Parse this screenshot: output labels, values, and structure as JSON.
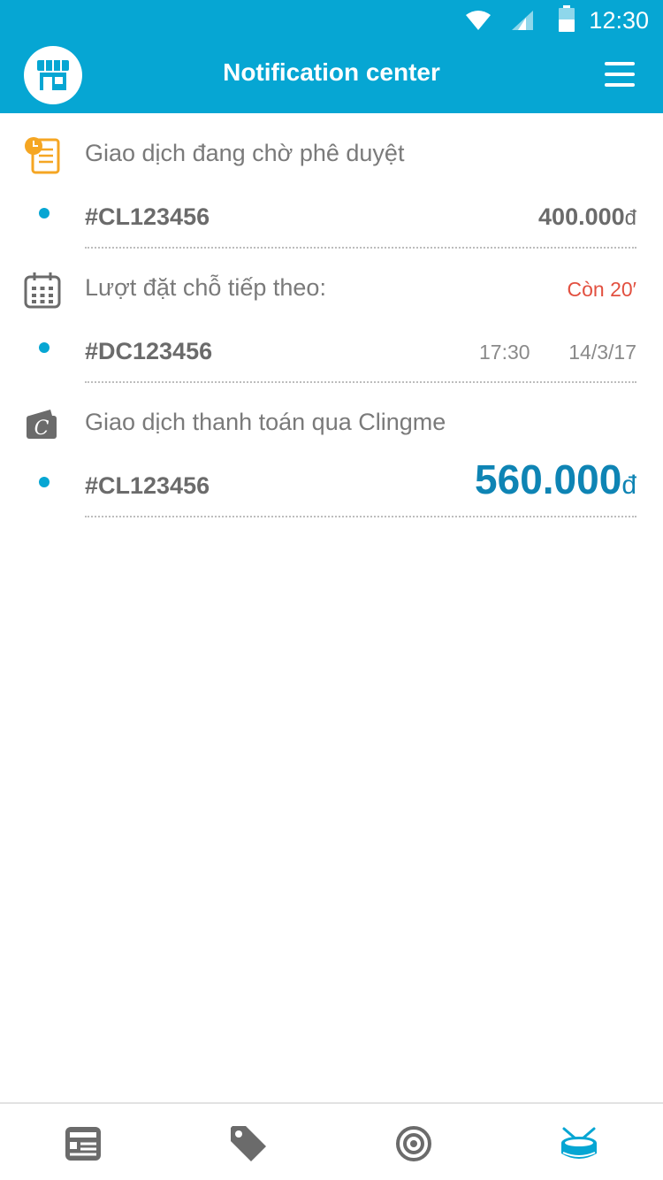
{
  "status_bar": {
    "time": "12:30"
  },
  "header": {
    "title": "Notification center"
  },
  "sections": [
    {
      "title": "Giao dịch đang chờ phê duyệt",
      "item": {
        "code": "#CL123456",
        "amount": "400.000",
        "currency": "đ"
      }
    },
    {
      "title": "Lượt đặt chỗ tiếp theo:",
      "badge": "Còn 20′",
      "item": {
        "code": "#DC123456",
        "time": "17:30",
        "date": "14/3/17"
      }
    },
    {
      "title": "Giao dịch thanh toán qua Clingme",
      "item": {
        "code": "#CL123456",
        "amount": "560.000",
        "currency": "đ"
      }
    }
  ],
  "tabs": [
    {
      "icon": "news-icon"
    },
    {
      "icon": "tag-icon"
    },
    {
      "icon": "target-icon"
    },
    {
      "icon": "drum-icon",
      "active": true
    }
  ],
  "colors": {
    "primary": "#06A6D3",
    "amount_highlight": "#0E84B4",
    "alert": "#e25040",
    "pending_icon": "#F5A623",
    "text_gray": "#7a7a7a"
  }
}
